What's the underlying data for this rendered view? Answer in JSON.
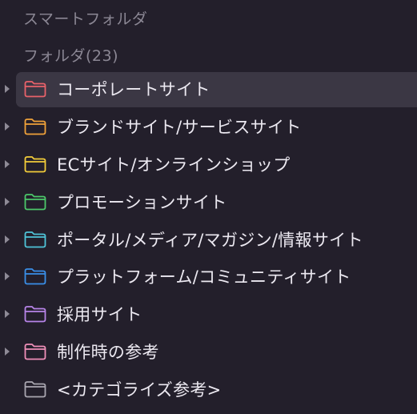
{
  "sidebar": {
    "smart_folders_label": "スマートフォルダ",
    "folders_label": "フォルダ(23)",
    "folders": [
      {
        "label": "コーポレートサイト",
        "color": "#e8626a",
        "expandable": true,
        "selected": true
      },
      {
        "label": "ブランドサイト/サービスサイト",
        "color": "#f0a23a",
        "expandable": true,
        "selected": false
      },
      {
        "label": "ECサイト/オンラインショップ",
        "color": "#f2cc3a",
        "expandable": true,
        "selected": false
      },
      {
        "label": "プロモーションサイト",
        "color": "#4cc86a",
        "expandable": true,
        "selected": false
      },
      {
        "label": "ポータル/メディア/マガジン/情報サイト",
        "color": "#4fc4d8",
        "expandable": true,
        "selected": false
      },
      {
        "label": "プラットフォーム/コミュニティサイト",
        "color": "#3a8fe8",
        "expandable": true,
        "selected": false
      },
      {
        "label": "採用サイト",
        "color": "#b784e8",
        "expandable": true,
        "selected": false
      },
      {
        "label": "制作時の参考",
        "color": "#ef8fb8",
        "expandable": true,
        "selected": false
      },
      {
        "label": "<カテゴライズ参考>",
        "color": "#a9a6b0",
        "expandable": false,
        "selected": false
      }
    ]
  }
}
